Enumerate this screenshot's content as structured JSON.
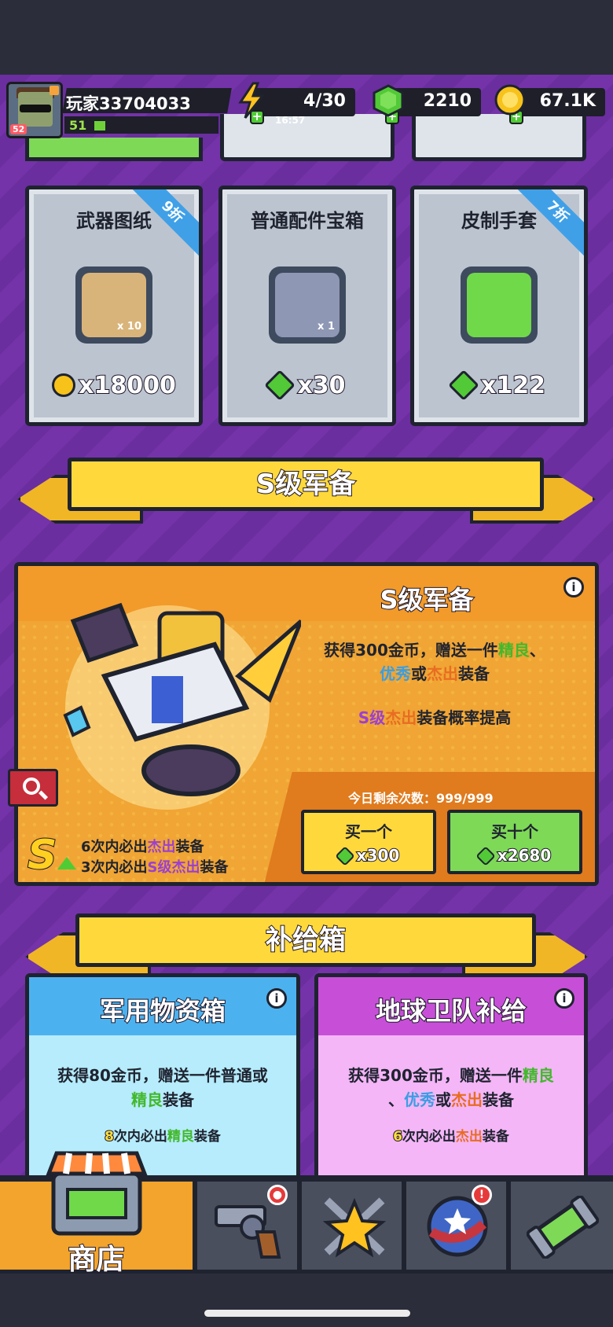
{
  "player": {
    "name": "玩家33704033",
    "level": "51",
    "avatar_level": "52"
  },
  "resources": {
    "energy": {
      "value": "4/30",
      "timer": "16:57"
    },
    "gems": {
      "value": "2210"
    },
    "coins": {
      "value": "67.1K"
    }
  },
  "cards": [
    {
      "title": "武器图纸",
      "qty": "x 10",
      "price": "x18000",
      "currency": "coin",
      "discount": "9折"
    },
    {
      "title": "普通配件宝箱",
      "qty": "x 1",
      "price": "x30",
      "currency": "gem",
      "discount": ""
    },
    {
      "title": "皮制手套",
      "qty": "",
      "price": "x122",
      "currency": "gem",
      "discount": "7折"
    }
  ],
  "s_section": {
    "banner": "S级军备",
    "title": "S级军备",
    "desc_line1_a": "获得300金币，赠送一件",
    "desc_line1_b": "精良",
    "desc_line1_c": "、",
    "desc_line2_a": "优秀",
    "desc_line2_b": "或",
    "desc_line2_c": "杰出",
    "desc_line2_d": "装备",
    "prob_a": "S级",
    "prob_b": "杰出",
    "prob_c": "装备概率提高",
    "remaining": "今日剩余次数：999/999",
    "buy_one_label": "买一个",
    "buy_one_price": "x300",
    "buy_ten_label": "买十个",
    "buy_ten_price": "x2680",
    "g1_a": "6次内必出",
    "g1_b": "杰出",
    "g1_c": "装备",
    "g2_a": "3次内必出",
    "g2_b": "S级杰出",
    "g2_c": "装备",
    "big_s": "S"
  },
  "supply_section": {
    "banner": "补给箱",
    "boxes": [
      {
        "title": "军用物资箱",
        "d1": "获得80金币，赠送一件普通或",
        "d2a": "精良",
        "d2b": "装备",
        "g_a": "8",
        "g_b": "次内必出",
        "g_c": "精良",
        "g_d": "装备"
      },
      {
        "title": "地球卫队补给",
        "d1a": "获得300金币，赠送一件",
        "d1b": "精良",
        "d2a": "、",
        "d2b": "优秀",
        "d2c": "或",
        "d2d": "杰出",
        "d2e": "装备",
        "g_a": "6",
        "g_b": "次内必出",
        "g_c": "杰出",
        "g_d": "装备"
      }
    ]
  },
  "nav": {
    "shop_label": "商店",
    "notif_weapons": "●",
    "notif_missions": "!"
  },
  "info_glyph": "i"
}
